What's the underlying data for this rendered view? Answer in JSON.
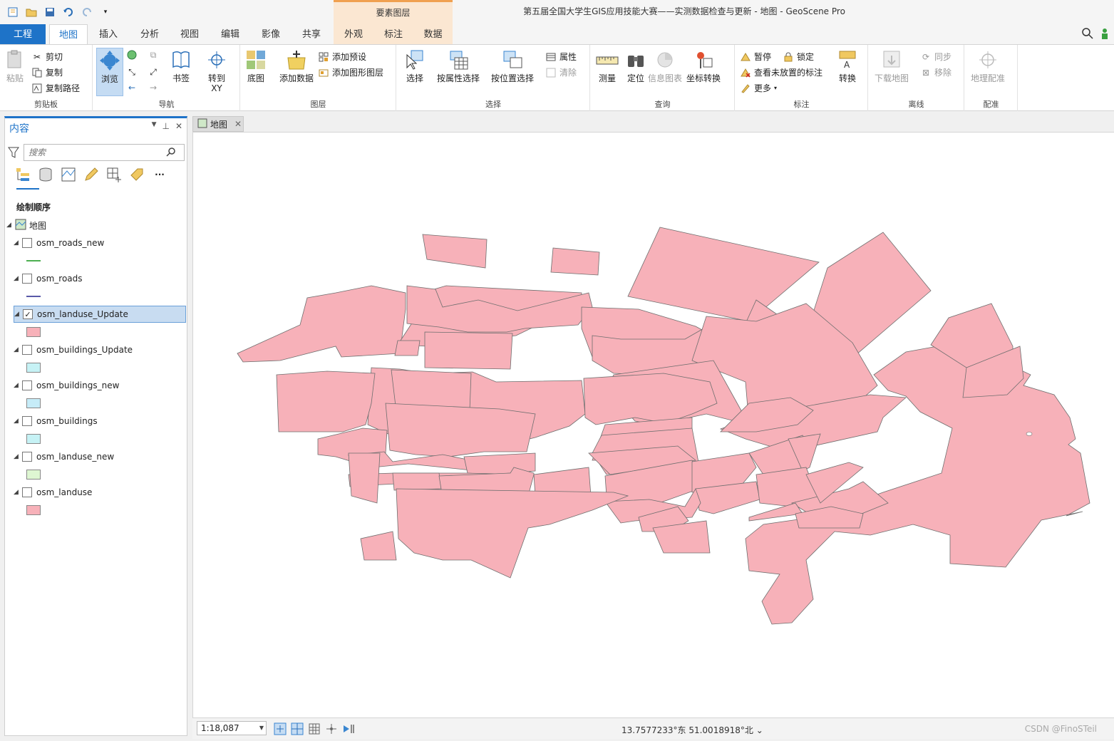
{
  "app": {
    "window_title": "第五届全国大学生GIS应用技能大赛——实测数据检查与更新 - 地图 - GeoScene Pro",
    "contextual_tab_group": "要素图层"
  },
  "tabs": {
    "project": "工程",
    "map": "地图",
    "insert": "插入",
    "analysis": "分析",
    "view": "视图",
    "edit": "编辑",
    "imagery": "影像",
    "share": "共享",
    "appearance": "外观",
    "labeling": "标注",
    "data": "数据"
  },
  "ribbon": {
    "clipboard": {
      "label": "剪贴板",
      "paste": "粘贴",
      "cut": "剪切",
      "copy": "复制",
      "copy_path": "复制路径"
    },
    "navigate": {
      "label": "导航",
      "explore": "浏览",
      "bookmarks": "书签",
      "goto_xy": "转到\nXY"
    },
    "layer": {
      "label": "图层",
      "basemap": "底图",
      "add_data": "添加数据",
      "add_preset": "添加预设",
      "add_graphics": "添加图形图层"
    },
    "selection": {
      "label": "选择",
      "select": "选择",
      "by_attribute": "按属性选择",
      "by_location": "按位置选择",
      "attributes": "属性",
      "clear": "清除"
    },
    "inquiry": {
      "label": "查询",
      "measure": "测量",
      "locate": "定位",
      "infographics": "信息图表",
      "coord_convert": "坐标转换"
    },
    "labeling": {
      "label": "标注",
      "pause": "暂停",
      "lock": "锁定",
      "view_unplaced": "查看未放置的标注",
      "more": "更多",
      "convert": "转换"
    },
    "offline": {
      "label": "离线",
      "download_map": "下载地图",
      "sync": "同步",
      "remove": "移除"
    },
    "georef": {
      "label": "配准",
      "georeference": "地理配准"
    }
  },
  "contents": {
    "title": "内容",
    "search_placeholder": "搜索",
    "drawing_order": "绘制顺序",
    "map_name": "地图",
    "layers": [
      {
        "name": "osm_roads_new",
        "checked": false,
        "symbol": "line",
        "color": "#4caf50"
      },
      {
        "name": "osm_roads",
        "checked": false,
        "symbol": "line",
        "color": "#5a5aa8"
      },
      {
        "name": "osm_landuse_Update",
        "checked": true,
        "symbol": "fill",
        "color": "#f7b1b9"
      },
      {
        "name": "osm_buildings_Update",
        "checked": false,
        "symbol": "fill",
        "color": "#c6f2f5"
      },
      {
        "name": "osm_buildings_new",
        "checked": false,
        "symbol": "fill",
        "color": "#c6ecf8"
      },
      {
        "name": "osm_buildings",
        "checked": false,
        "symbol": "fill",
        "color": "#c6f2f5"
      },
      {
        "name": "osm_landuse_new",
        "checked": false,
        "symbol": "fill",
        "color": "#def6d2"
      },
      {
        "name": "osm_landuse",
        "checked": false,
        "symbol": "fill",
        "color": "#f7b1b9"
      }
    ]
  },
  "map_view": {
    "tab_label": "地图",
    "polygon_fill": "#f7b1b9",
    "polygon_stroke": "#6e6e6e"
  },
  "status": {
    "scale": "1:18,087",
    "coordinates": "13.7577233°东 51.0018918°北",
    "watermark": "CSDN @FinoSTeil"
  }
}
